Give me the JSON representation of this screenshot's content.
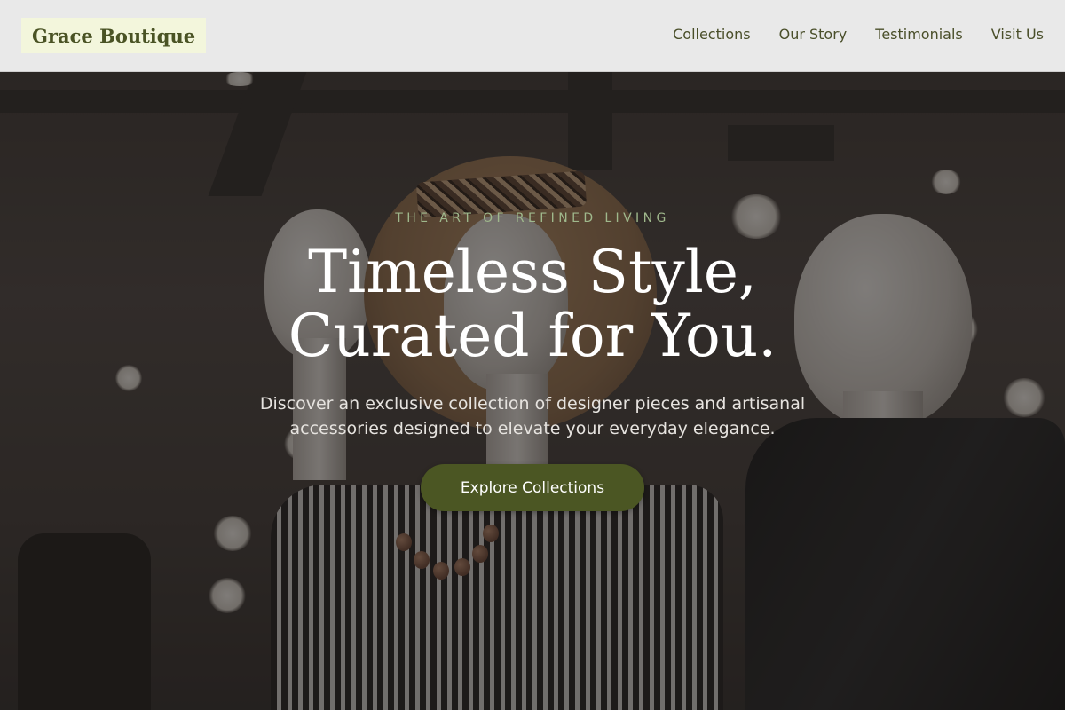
{
  "header": {
    "brand": "Grace Boutique",
    "nav": [
      {
        "label": "Collections"
      },
      {
        "label": "Our Story"
      },
      {
        "label": "Testimonials"
      },
      {
        "label": "Visit Us"
      }
    ]
  },
  "hero": {
    "eyebrow": "THE ART OF REFINED LIVING",
    "headline_line1": "Timeless Style,",
    "headline_line2": "Curated for You.",
    "subtext": "Discover an exclusive collection of designer pieces and artisanal accessories designed to elevate your everyday elegance.",
    "cta_label": "Explore Collections",
    "background": "boutique-mannequins-photo"
  },
  "colors": {
    "header_bg": "#e9e9e9",
    "logo_bg": "#f3f6dc",
    "brand_text": "#4a5324",
    "accent_green": "#4b5623",
    "eyebrow_green": "#9fb88c"
  }
}
